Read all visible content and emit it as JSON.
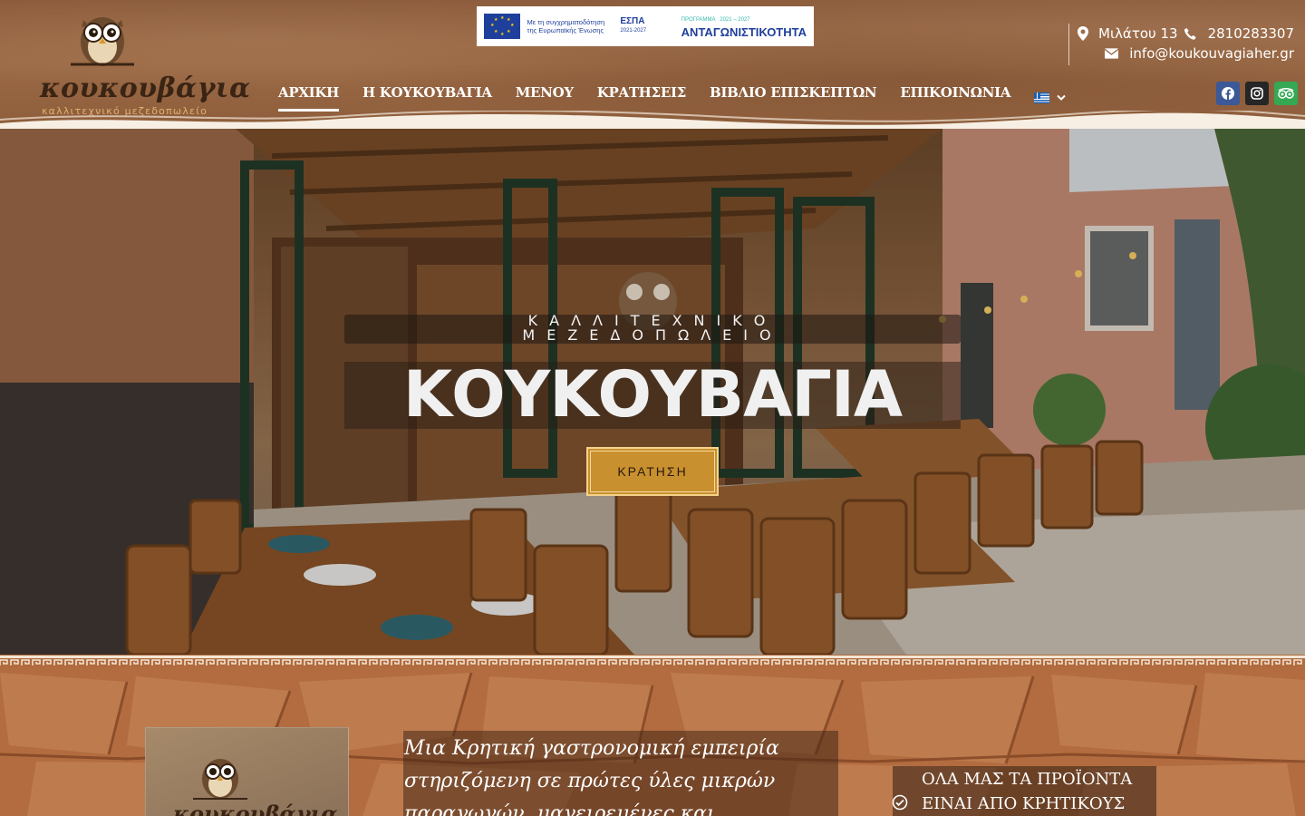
{
  "header": {
    "logo_text": "κουκουβάγια",
    "logo_sub": "καλλιτεχνικό μεζεδοπωλείο",
    "espa": {
      "eu_text": "Με τη συγχρηματοδότηση της Ευρωπαϊκής Ένωσης",
      "espa_label": "ΕΣΠΑ",
      "espa_years": "2021-2027",
      "program_label": "ΠΡΟΓΡΑΜΜΑ",
      "program_years": "2021 – 2027",
      "program_name": "ΑΝΤΑΓΩΝΙΣΤΙΚΟΤΗΤΑ"
    },
    "contact": {
      "address": "Μιλάτου 13",
      "phone": "2810283307",
      "email": "info@koukouvagiaher.gr"
    },
    "nav": [
      {
        "label": "ΑΡΧΙΚΗ",
        "active": true
      },
      {
        "label": "Η ΚΟΥΚΟΥΒΑΓΙΑ",
        "active": false
      },
      {
        "label": "ΜΕΝΟΥ",
        "active": false
      },
      {
        "label": "ΚΡΑΤΗΣΕΙΣ",
        "active": false
      },
      {
        "label": "ΒΙΒΛΙΟ ΕΠΙΣΚΕΠΤΩΝ",
        "active": false
      },
      {
        "label": "ΕΠΙΚΟΙΝΩΝΙΑ",
        "active": false
      }
    ],
    "social": [
      {
        "name": "facebook-icon",
        "color": "#3b5998"
      },
      {
        "name": "instagram-icon",
        "color": "#262626"
      },
      {
        "name": "tripadvisor-icon",
        "color": "#34a853"
      }
    ]
  },
  "hero": {
    "subtitle_line1": "ΚΑΛΛΙΤΕΧΝΙΚΟ",
    "subtitle_line2": "ΜΕΖΕΔΟΠΩΛΕΙΟ",
    "title": "ΚΟΥΚΟΥΒΑΓΙΑ",
    "button_label": "ΚΡΑΤΗΣΗ",
    "accent_color": "#c9902f"
  },
  "about": {
    "text": "Μια Κρητική γαστρονομική εμπειρία στηριζόμενη σε πρώτες ύλες μικρών παραγωγών, μαγειρεμένες και",
    "feature": "ΟΛΑ ΜΑΣ ΤΑ ΠΡΟΪΟΝΤΑ ΕΙΝΑΙ ΑΠΟ ΚΡΗΤΙΚΟΥΣ"
  }
}
